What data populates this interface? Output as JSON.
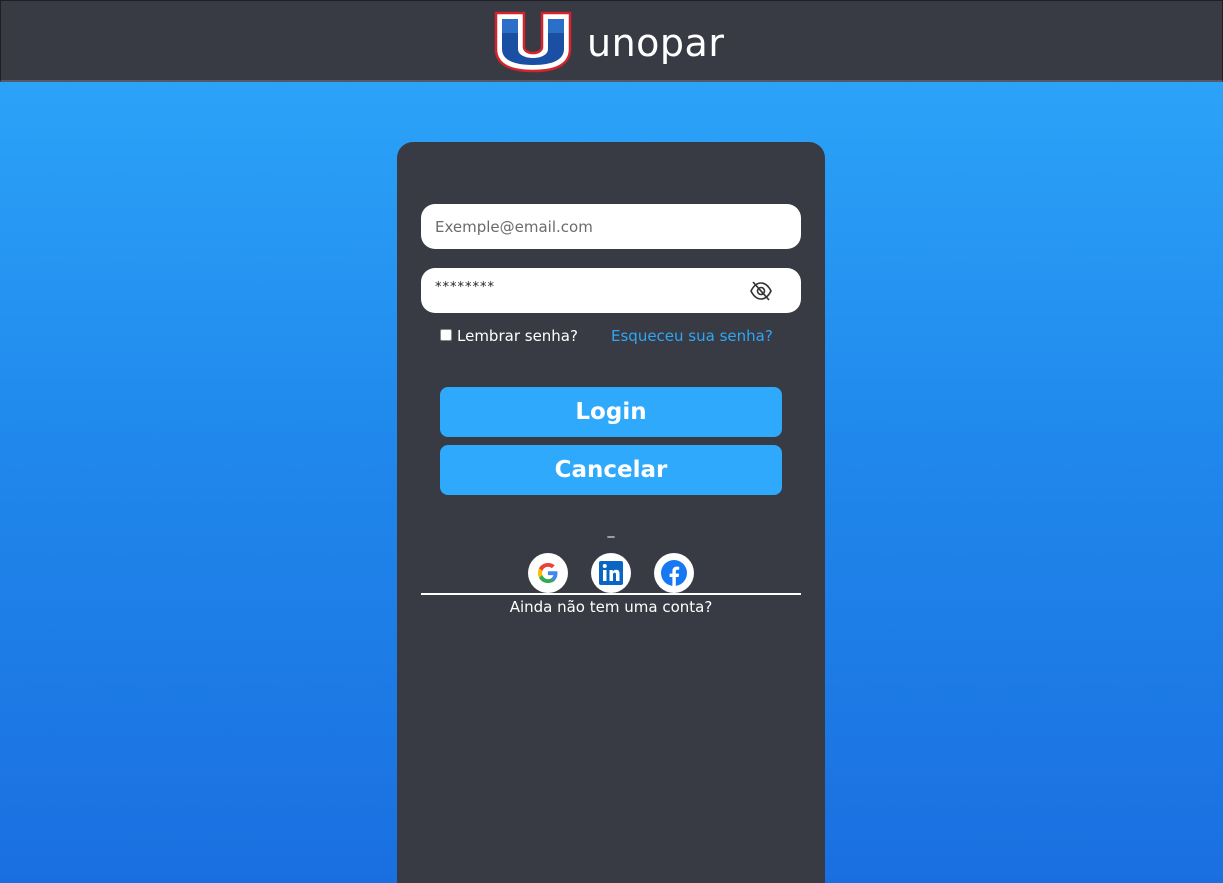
{
  "header": {
    "brand": "unopar",
    "logo_icon": "unopar-u-logo"
  },
  "login": {
    "email_placeholder": "Exemple@email.com",
    "password_value": "********",
    "remember_label": "Lembrar senha?",
    "remember_checked": false,
    "forgot_link": "Esqueceu sua senha?",
    "login_button": "Login",
    "cancel_button": "Cancelar",
    "separator": "_",
    "social": [
      {
        "name": "google-icon"
      },
      {
        "name": "linkedin-icon"
      },
      {
        "name": "facebook-icon"
      }
    ],
    "signup_prompt": "Ainda não tem uma conta?"
  },
  "colors": {
    "topbar": "#393b44",
    "card": "#393b44",
    "accent": "#2ea9fb",
    "link": "#2ea6f5",
    "background_top": "#2ea9fb",
    "background_bottom": "#1a6fe0"
  }
}
